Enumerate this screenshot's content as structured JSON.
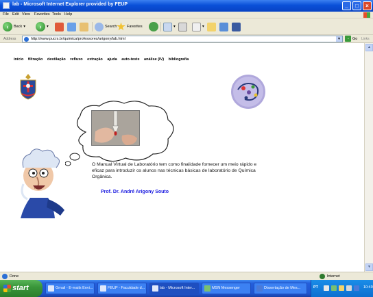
{
  "window": {
    "title": "lab - Microsoft Internet Explorer provided by FEUP"
  },
  "menu": {
    "items": [
      "File",
      "Edit",
      "View",
      "Favorites",
      "Tools",
      "Help"
    ]
  },
  "toolbar": {
    "back_label": "Back",
    "search_label": "Search",
    "favorites_label": "Favorites"
  },
  "address": {
    "label": "Address",
    "url": "http://www.pucrs.br/quimica/professores/arigony/lab.html",
    "go_label": "Go",
    "links_label": "Links"
  },
  "page": {
    "nav": [
      "início",
      "filtração",
      "destilação",
      "refluxo",
      "extração",
      "ajuda",
      "auto-teste",
      "análise (IV)",
      "bibliografia"
    ],
    "description": "O Manual Virtual de Laboratório tem como finalidade fornecer um meio rápido e eficaz para introduzir os alunos nas técnicas básicas de laboratório de Química Orgânica.",
    "author": "Prof. Dr. André Arigony Souto"
  },
  "status": {
    "text": "Done",
    "zone": "Internet"
  },
  "taskbar": {
    "start_label": "start",
    "tasks": [
      {
        "label": "Gmail - E-mails Envi..."
      },
      {
        "label": "FEUP - Faculdade d..."
      },
      {
        "label": "lab - Microsoft Inter..."
      },
      {
        "label": "MSN Messenger"
      },
      {
        "label": "Dissertação de Mes..."
      }
    ],
    "language": "PT",
    "clock": "10:49"
  },
  "colors": {
    "titlebar": "#0a50d8",
    "author_link": "#1a1ae0",
    "start_button": "#3a963a"
  }
}
